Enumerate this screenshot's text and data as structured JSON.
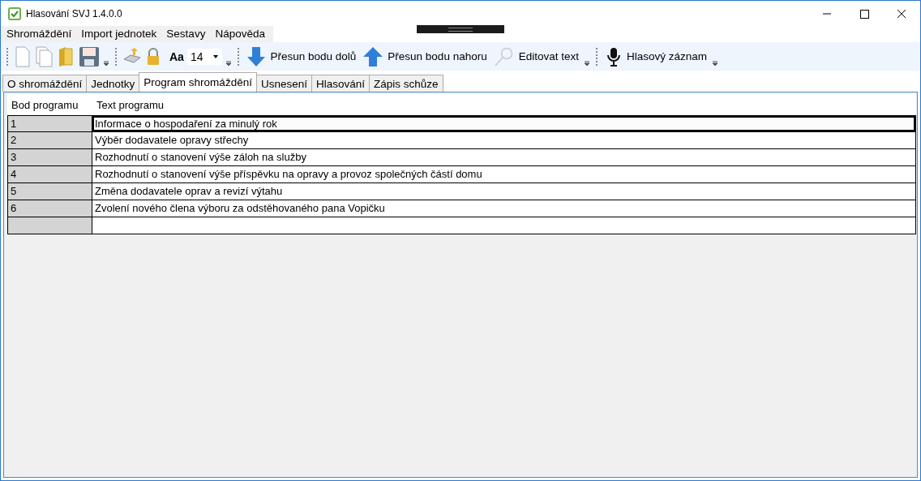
{
  "window": {
    "title": "Hlasování SVJ 1.4.0.0"
  },
  "menu": [
    "Shromáždění",
    "Import jednotek",
    "Sestavy",
    "Nápověda"
  ],
  "toolbar": {
    "font_label": "Aa",
    "font_size": "14",
    "buttons": [
      {
        "kind": "down",
        "label": "Přesun bodu dolů"
      },
      {
        "kind": "up",
        "label": "Přesun bodu nahoru"
      },
      {
        "kind": "find",
        "label": "Editovat text"
      },
      {
        "kind": "mic",
        "label": "Hlasový záznam"
      }
    ]
  },
  "tabs": [
    {
      "label": "O shromáždění",
      "selected": false
    },
    {
      "label": "Jednotky",
      "selected": false
    },
    {
      "label": "Program shromáždění",
      "selected": true
    },
    {
      "label": "Usnesení",
      "selected": false
    },
    {
      "label": "Hlasování",
      "selected": false
    },
    {
      "label": "Zápis schůze",
      "selected": false
    }
  ],
  "table": {
    "columns": [
      "Bod programu",
      "Text programu"
    ],
    "rows": [
      {
        "number": "1",
        "text": "Informace o hospodaření za minulý rok",
        "selected": true
      },
      {
        "number": "2",
        "text": "Výběr dodavatele opravy střechy",
        "selected": false
      },
      {
        "number": "3",
        "text": "Rozhodnutí o stanovení výše záloh na služby",
        "selected": false
      },
      {
        "number": "4",
        "text": "Rozhodnutí o stanovení výše příspěvku na opravy a provoz společných částí domu",
        "selected": false
      },
      {
        "number": "5",
        "text": "Změna dodavatele oprav a revizí výtahu",
        "selected": false
      },
      {
        "number": "6",
        "text": "Zvolení nového člena výboru za odstěhovaného pana Vopičku",
        "selected": false
      }
    ]
  }
}
